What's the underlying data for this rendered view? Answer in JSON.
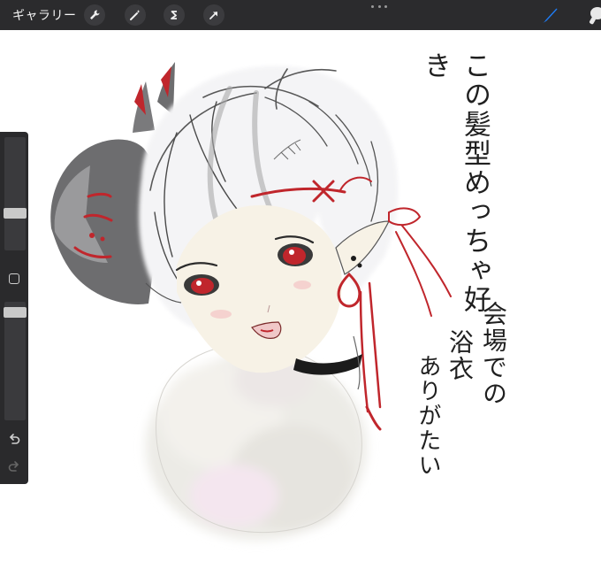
{
  "toolbar": {
    "gallery_label": "ギャラリー",
    "left_tools": [
      {
        "icon": "wrench-icon"
      },
      {
        "icon": "magic-wand-icon"
      },
      {
        "icon": "selection-icon"
      },
      {
        "icon": "transform-arrow-icon"
      }
    ],
    "more_icon": "more-dots-icon",
    "right_tools": [
      {
        "icon": "brush-icon",
        "active": true,
        "color": "#1e7cf5"
      },
      {
        "icon": "smudge-icon",
        "active": false
      }
    ]
  },
  "sidebar": {
    "brush_size_icon": "brush-size-slider",
    "modifier_icon": "modifier-square-icon",
    "opacity_icon": "opacity-slider",
    "undo_icon": "undo-icon",
    "redo_icon": "redo-icon"
  },
  "canvas": {
    "handwriting_line1": "この髪型めっちゃ好き",
    "handwriting_line2": "会場での",
    "handwriting_line3": "浴衣",
    "handwriting_line4": "ありがたい"
  },
  "colors": {
    "toolbar_bg": "#2b2b2d",
    "accent": "#1e7cf5",
    "hair_red": "#c0262c"
  }
}
